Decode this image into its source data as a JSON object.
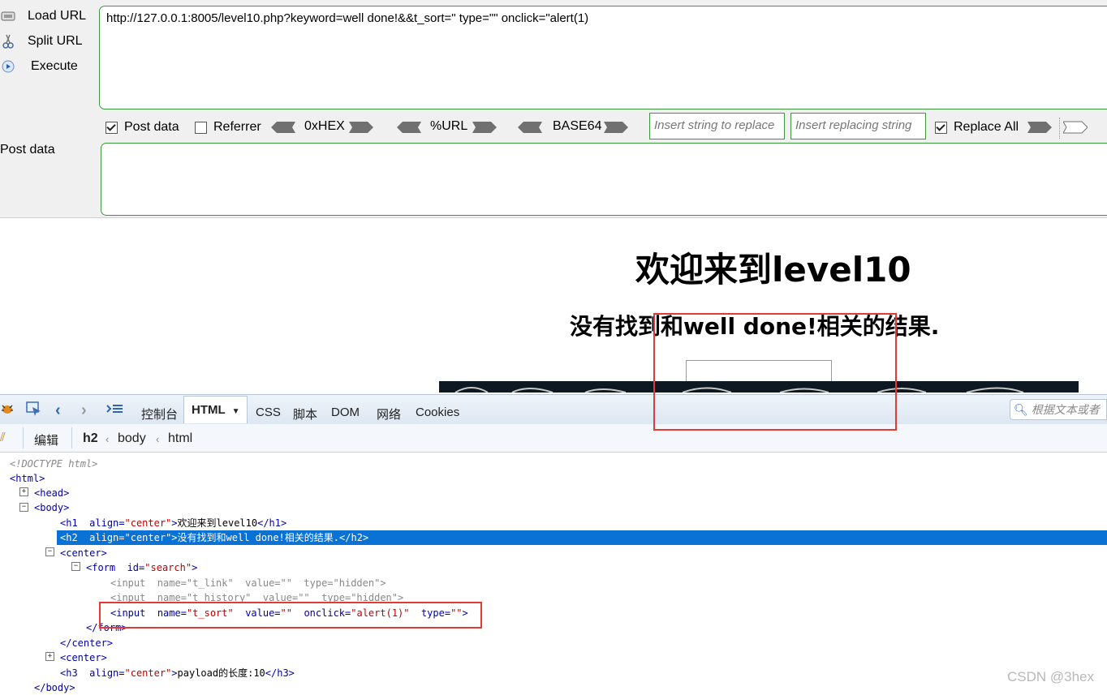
{
  "hackbar": {
    "load_url": "Load URL",
    "split_url": "Split URL",
    "execute": "Execute",
    "url_value": "http://127.0.0.1:8005/level10.php?keyword=well done!&&t_sort=\" type=\"\" onclick=\"alert(1)",
    "post_data_checkbox": "Post data",
    "referrer_checkbox": "Referrer",
    "hex_label": "0xHEX",
    "url_label": "%URL",
    "base64_label": "BASE64",
    "insert_placeholder": "Insert string to replace",
    "replacing_placeholder": "Insert replacing string",
    "replace_all": "Replace All",
    "post_data_label": "Post data",
    "post_data_checked": true,
    "referrer_checked": false,
    "replace_all_checked": true
  },
  "page": {
    "h1": "欢迎来到level10",
    "h2": "没有找到和well done!相关的结果."
  },
  "devtools": {
    "tabs": [
      "控制台",
      "HTML",
      "CSS",
      "脚本",
      "DOM",
      "网络",
      "Cookies"
    ],
    "active_tab": "HTML",
    "search_placeholder": "根据文本或者",
    "edit_label": "编辑",
    "breadcrumb": [
      "h2",
      "body",
      "html"
    ]
  },
  "tree": {
    "doctype": "<!DOCTYPE html>",
    "html_open": "<html>",
    "head": "<head>",
    "body_open": "<body>",
    "h1_tag": "<h1",
    "h1_attr": "align=",
    "h1_val": "\"center\"",
    "h1_text": "欢迎来到level10",
    "h1_close": "</h1>",
    "h2_tag": "<h2",
    "h2_attr": "align=",
    "h2_val": "\"center\"",
    "h2_text": "没有找到和well done!相关的结果.",
    "h2_close": "</h2>",
    "center_open": "<center>",
    "form_tag": "<form",
    "form_attr": "id=",
    "form_val": "\"search\"",
    "input1": "<input  name=\"t_link\"  value=\"\"  type=\"hidden\">",
    "input2": "<input  name=\"t_history\"  value=\"\"  type=\"hidden\">",
    "input3_tag": "<input",
    "input3_name_attr": "name=",
    "input3_name_val": "\"t_sort\"",
    "input3_value_attr": "value=",
    "input3_value_val": "\"\"",
    "input3_onclick_attr": "onclick=",
    "input3_onclick_val": "\"alert(1)\"",
    "input3_type_attr": "type=",
    "input3_type_val": "\"\"",
    "form_close": "</form>",
    "center_close": "</center>",
    "center2": "<center>",
    "h3_tag": "<h3",
    "h3_attr": "align=",
    "h3_val": "\"center\"",
    "h3_text": "payload的长度:10",
    "h3_close": "</h3>",
    "body_close": "</body>"
  },
  "watermark": "CSDN @3hex",
  "colors": {
    "accent_green": "#3c9a3c",
    "selection_blue": "#0a72d4",
    "annotation_red": "#e53935"
  }
}
